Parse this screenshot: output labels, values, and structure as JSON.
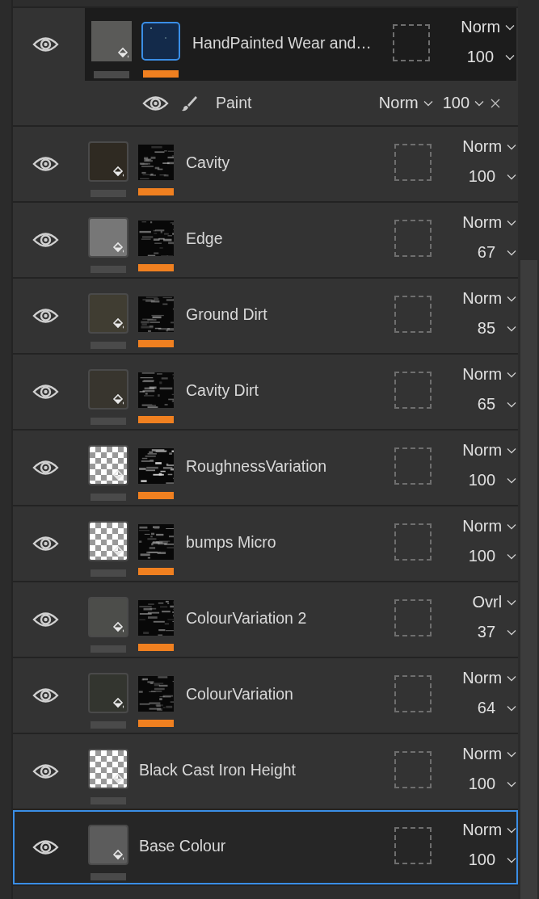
{
  "layers": [
    {
      "name": "HandPainted Wear and…",
      "visible": true,
      "active": true,
      "selected": false,
      "color": "#5a5a58",
      "mask": true,
      "blend": "Norm",
      "opacity": "100",
      "effects": [
        {
          "name": "Paint",
          "visible": true,
          "blend": "Norm",
          "opacity": "100"
        }
      ]
    },
    {
      "name": "Cavity",
      "visible": true,
      "active": false,
      "selected": false,
      "color": "#2f2a22",
      "mask": true,
      "blend": "Norm",
      "opacity": "100"
    },
    {
      "name": "Edge",
      "visible": true,
      "active": false,
      "selected": false,
      "color": "#777777",
      "mask": true,
      "blend": "Norm",
      "opacity": "67"
    },
    {
      "name": "Ground Dirt",
      "visible": true,
      "active": false,
      "selected": false,
      "color": "#403d32",
      "mask": true,
      "blend": "Norm",
      "opacity": "85"
    },
    {
      "name": "Cavity Dirt",
      "visible": true,
      "active": false,
      "selected": false,
      "color": "#38352e",
      "mask": true,
      "blend": "Norm",
      "opacity": "65"
    },
    {
      "name": "RoughnessVariation",
      "visible": true,
      "active": false,
      "selected": false,
      "mask": true,
      "blend": "Norm",
      "opacity": "100"
    },
    {
      "name": "bumps Micro",
      "visible": true,
      "active": false,
      "selected": false,
      "mask": true,
      "blend": "Norm",
      "opacity": "100"
    },
    {
      "name": "ColourVariation 2",
      "visible": true,
      "active": false,
      "selected": false,
      "color": "#4c4d4a",
      "mask": true,
      "blend": "Ovrl",
      "opacity": "37"
    },
    {
      "name": "ColourVariation",
      "visible": true,
      "active": false,
      "selected": false,
      "color": "#33352f",
      "mask": true,
      "blend": "Norm",
      "opacity": "64"
    },
    {
      "name": "Black Cast Iron Height",
      "visible": true,
      "active": false,
      "selected": false,
      "mask": false,
      "blend": "Norm",
      "opacity": "100"
    },
    {
      "name": "Base Colour",
      "visible": true,
      "active": false,
      "selected": true,
      "color": "#5c5c5c",
      "mask": false,
      "blend": "Norm",
      "opacity": "100"
    }
  ]
}
